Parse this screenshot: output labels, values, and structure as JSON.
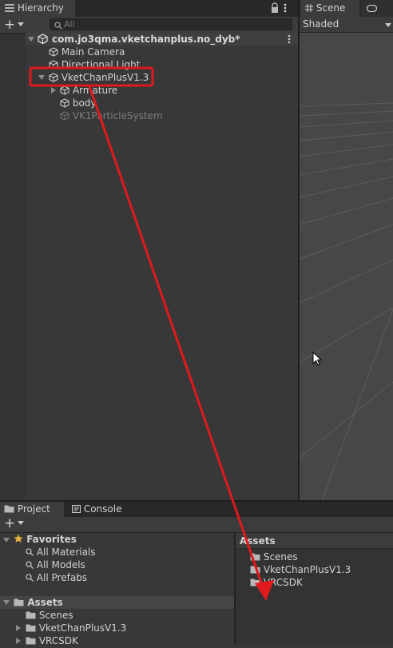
{
  "hierarchy": {
    "tab_label": "Hierarchy",
    "add_label": "+",
    "search_placeholder": "All",
    "scene_name": "com.jo3qma.vketchanplus.no_dyb*",
    "items": [
      {
        "label": "Main Camera"
      },
      {
        "label": "Directional Light"
      },
      {
        "label": "VketChanPlusV1.3"
      },
      {
        "label": "Armature"
      },
      {
        "label": "body"
      },
      {
        "label": "VK1ParticleSystem"
      }
    ]
  },
  "scene_view": {
    "tab_scene": "Scene",
    "tab_game": "Ga",
    "shading_mode": "Shaded"
  },
  "project": {
    "tab_project": "Project",
    "tab_console": "Console",
    "add_label": "+",
    "favorites_label": "Favorites",
    "favorites": [
      "All Materials",
      "All Models",
      "All Prefabs"
    ],
    "assets_label": "Assets",
    "assets_tree": [
      "Scenes",
      "VketChanPlusV1.3",
      "VRCSDK"
    ],
    "breadcrumb": "Assets",
    "assets_content": [
      "Scenes",
      "VketChanPlusV1.3",
      "VRCSDK"
    ]
  },
  "colors": {
    "highlight_box": "#e0191d",
    "arrow": "#e0191d",
    "favorites_star": "#e8b13a"
  }
}
